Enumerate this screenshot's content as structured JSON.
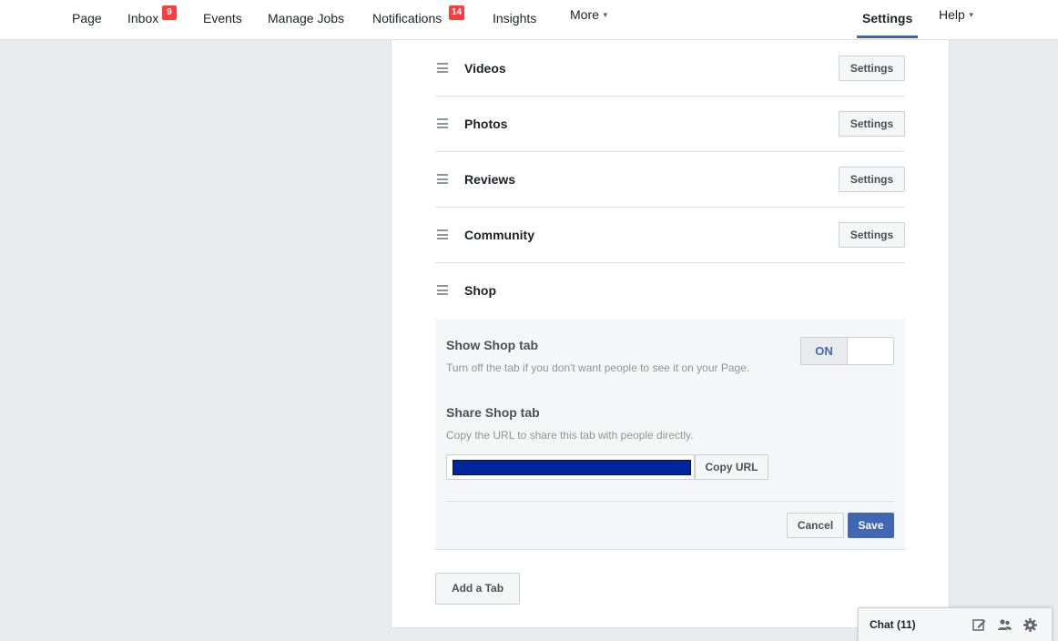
{
  "nav": {
    "page": "Page",
    "inbox": "Inbox",
    "inbox_badge": "9",
    "events": "Events",
    "manage_jobs": "Manage Jobs",
    "notifications": "Notifications",
    "notifications_badge": "14",
    "insights": "Insights",
    "more": "More",
    "settings": "Settings",
    "help": "Help"
  },
  "tabs": [
    {
      "label": "Videos",
      "button": "Settings"
    },
    {
      "label": "Photos",
      "button": "Settings"
    },
    {
      "label": "Reviews",
      "button": "Settings"
    },
    {
      "label": "Community",
      "button": "Settings"
    },
    {
      "label": "Shop"
    }
  ],
  "shop": {
    "show_title": "Show Shop tab",
    "show_desc": "Turn off the tab if you don't want people to see it on your Page.",
    "toggle_state": "ON",
    "share_title": "Share Shop tab",
    "share_desc": "Copy the URL to share this tab with people directly.",
    "copy_url": "Copy URL",
    "cancel": "Cancel",
    "save": "Save"
  },
  "add_tab": "Add a Tab",
  "chat": {
    "label": "Chat (11)"
  },
  "colors": {
    "accent": "#4267b2",
    "badge": "#fa3e3e",
    "background": "#e9ebee"
  }
}
